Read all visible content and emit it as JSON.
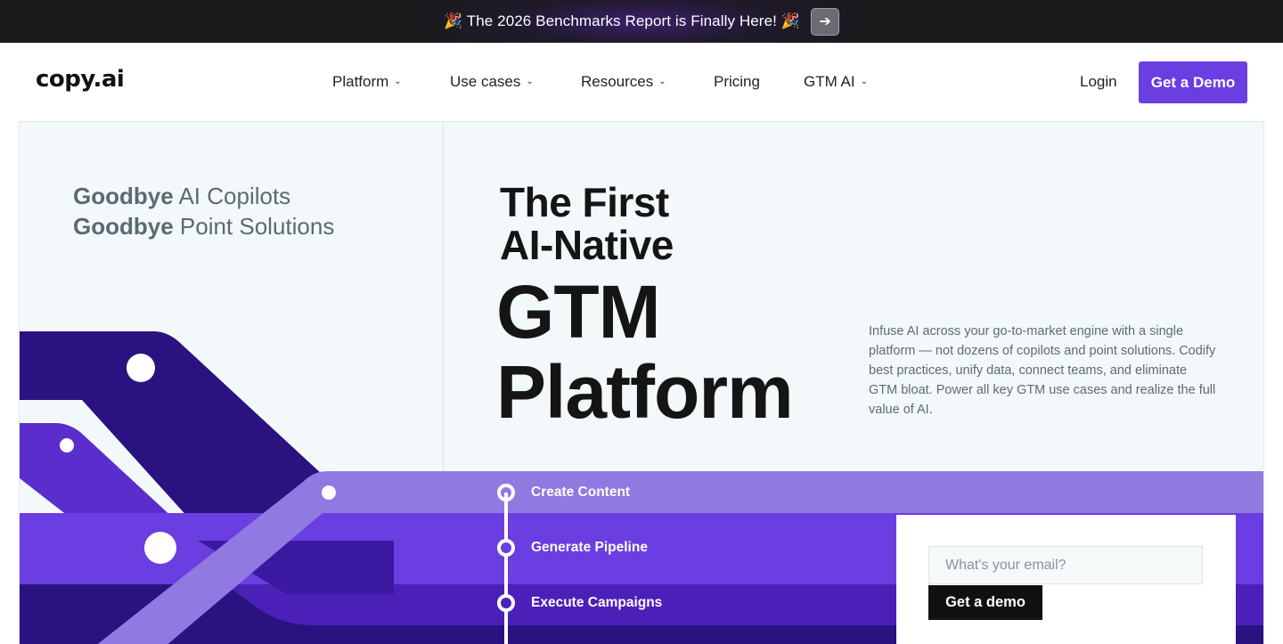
{
  "announcement": {
    "text": "🎉 The 2026 Benchmarks Report is Finally Here! 🎉",
    "arrow": "➔"
  },
  "nav": {
    "logo": "copy.ai",
    "items": [
      {
        "label": "Platform",
        "dropdown": true
      },
      {
        "label": "Use cases",
        "dropdown": true
      },
      {
        "label": "Resources",
        "dropdown": true
      },
      {
        "label": "Pricing",
        "dropdown": false
      },
      {
        "label": "GTM AI",
        "dropdown": true
      }
    ],
    "chevron": "⌄",
    "login": "Login",
    "cta": "Get a Demo"
  },
  "hero": {
    "goodbye": [
      {
        "bold": "Goodbye",
        "rest": " AI Copilots"
      },
      {
        "bold": "Goodbye",
        "rest": " Point Solutions"
      }
    ],
    "headline_small": [
      "The First",
      "AI-Native"
    ],
    "headline_large": [
      "GTM",
      "Platform"
    ],
    "description": "Infuse AI across your go-to-market engine with a single platform — not dozens of copilots and point solutions. Codify best practices, unify data, connect teams, and eliminate GTM bloat. Power all key GTM use cases and realize the full value of AI.",
    "steps": [
      "Create Content",
      "Generate Pipeline",
      "Execute Campaigns"
    ],
    "email_placeholder": "What's your email?",
    "email_button": "Get a demo"
  },
  "colors": {
    "brand": "#6a3ee0",
    "dark_purple": "#2a1380",
    "mid_purple": "#6a3ee0",
    "light_purple": "#9079e0",
    "bg": "#f3f9fa"
  }
}
